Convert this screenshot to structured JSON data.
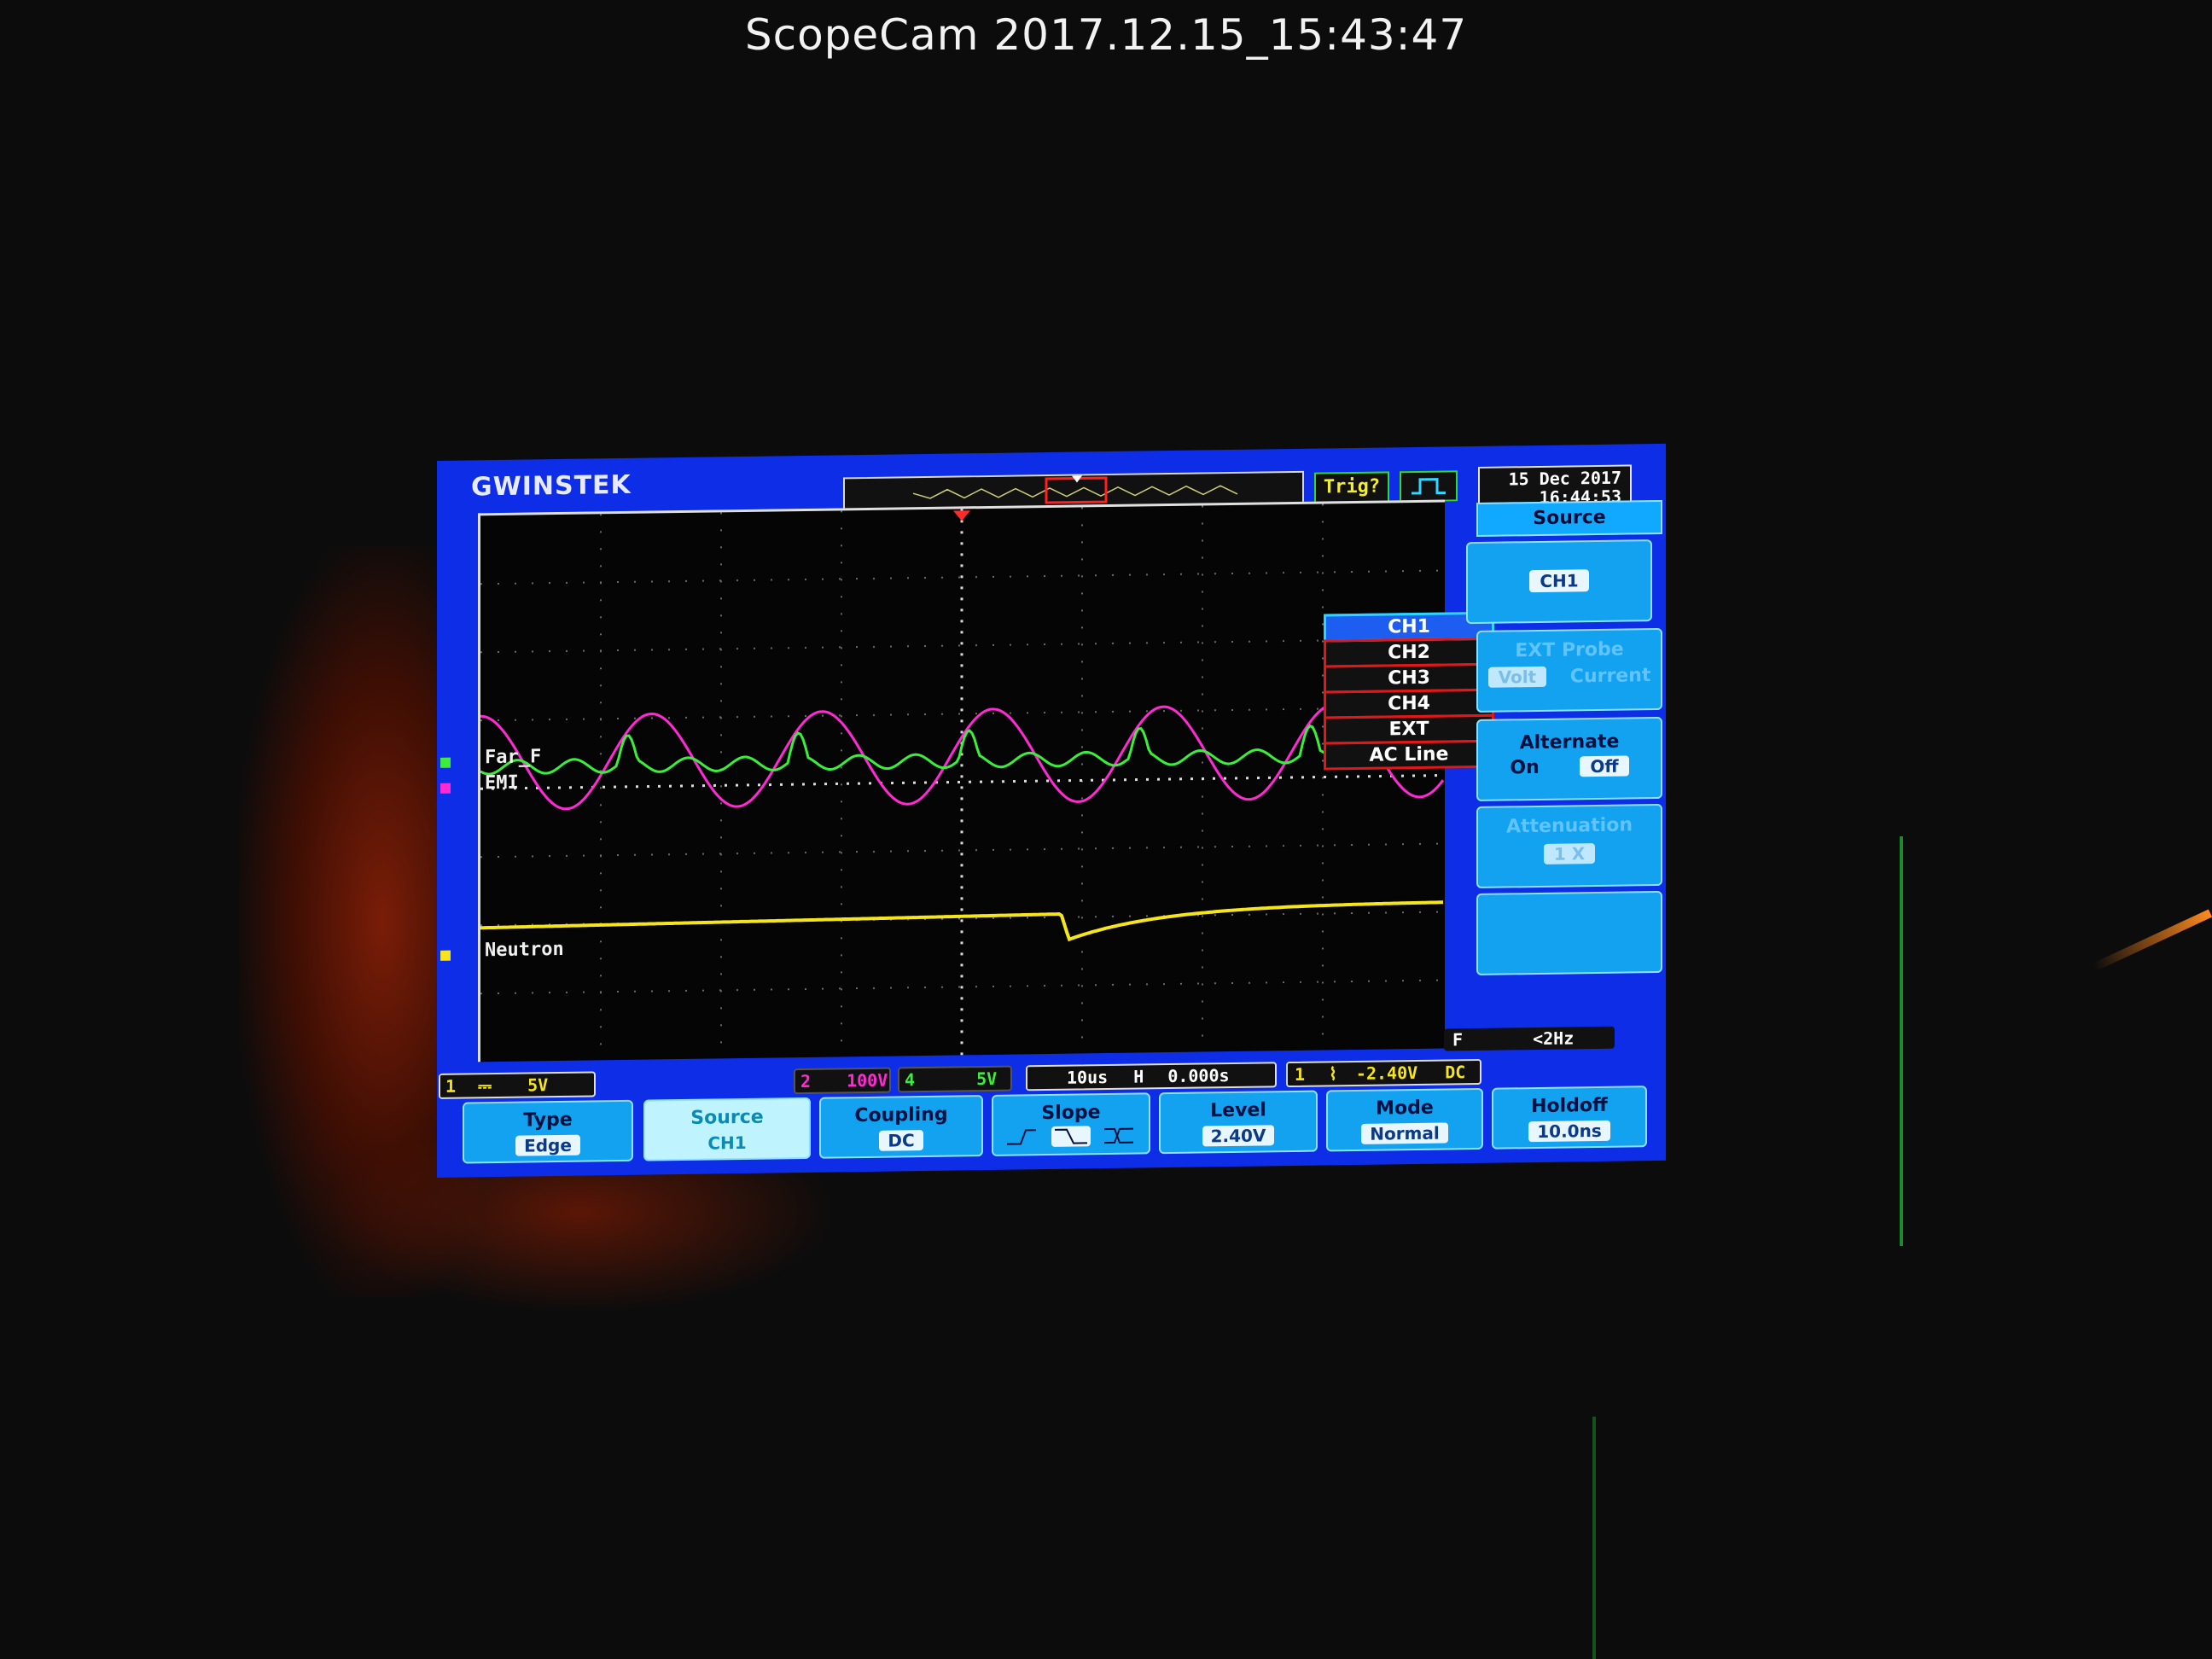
{
  "camera": {
    "title": "ScopeCam  2017.12.15_15:43:47"
  },
  "scope": {
    "brand": "GWINSTEK",
    "trigger_status": "Trig?",
    "date": "15 Dec 2017",
    "time": "16:44:53",
    "channels": [
      {
        "id": "1",
        "label": "Neutron",
        "color": "#f6e51c",
        "scale": "5V"
      },
      {
        "id": "2",
        "label": "EMI",
        "color": "#ff2ad4",
        "scale": "100V"
      },
      {
        "id": "4",
        "label": "Far_F",
        "color": "#3cee3c",
        "scale": "5V"
      }
    ],
    "source_menu": {
      "items": [
        "CH1",
        "CH2",
        "CH3",
        "CH4",
        "EXT",
        "AC Line"
      ],
      "selected": "CH1"
    },
    "side_panel": {
      "title": "Source",
      "source_value": "CH1",
      "ext_probe_label": "EXT Probe",
      "ext_probe_options": [
        "Volt",
        "Current"
      ],
      "alternate_label": "Alternate",
      "alternate_options": [
        "On",
        "Off"
      ],
      "attenuation_label": "Attenuation",
      "attenuation_value": "1 X"
    },
    "status": {
      "ch1_coupling_symbol": "⎓",
      "timebase": "10us",
      "horizontal_pos": "0.000s",
      "freq_label": "F",
      "freq_value": "<2Hz",
      "trigger_level": "-2.40V",
      "trigger_coupling": "DC"
    },
    "bottom_menu": {
      "type_label": "Type",
      "type_value": "Edge",
      "source_label": "Source",
      "source_value": "CH1",
      "coupling_label": "Coupling",
      "coupling_value": "DC",
      "slope_label": "Slope",
      "level_label": "Level",
      "level_value": "2.40V",
      "mode_label": "Mode",
      "mode_value": "Normal",
      "holdoff_label": "Holdoff",
      "holdoff_value": "10.0ns"
    }
  }
}
